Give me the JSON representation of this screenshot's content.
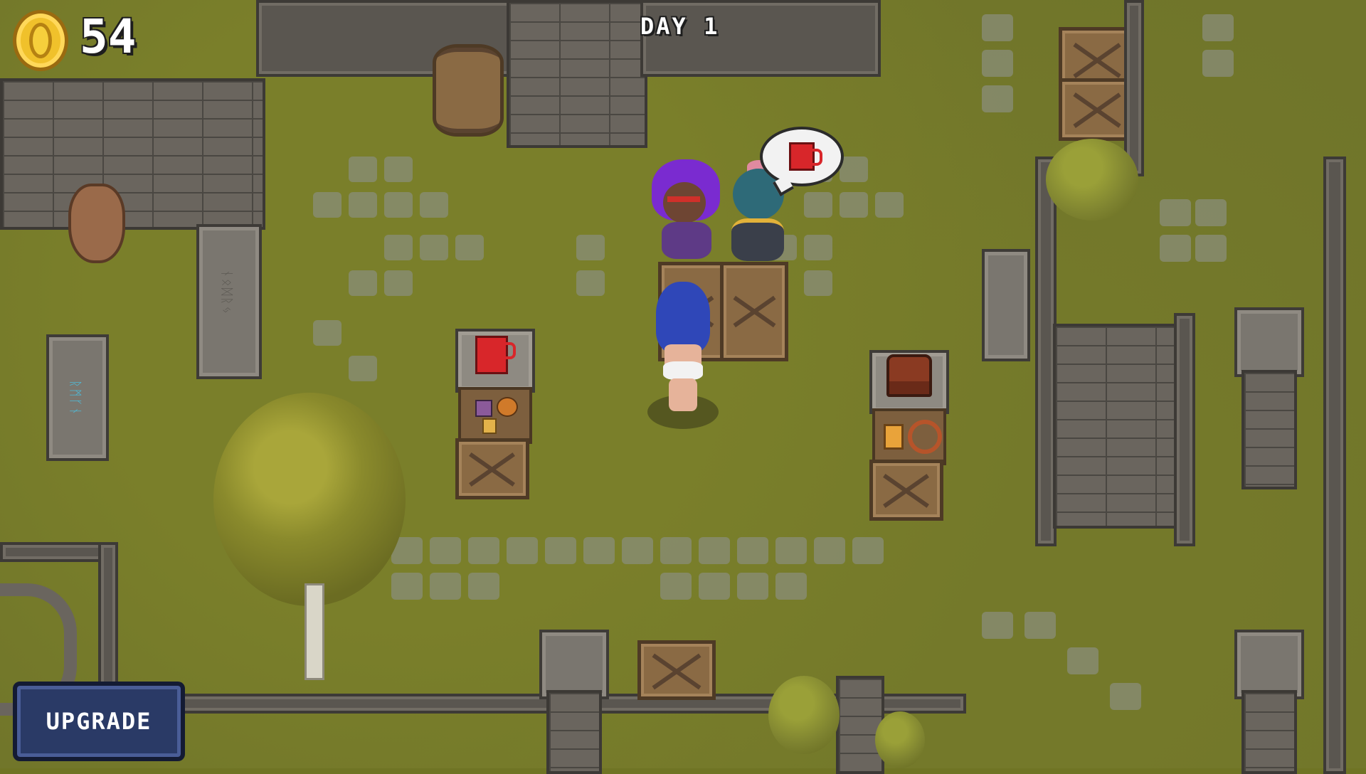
{
  "hud": {
    "coins": "54",
    "day": "DAY 1",
    "coin_color": "#f0c12b"
  },
  "buttons": {
    "upgrade": "UPGRADE",
    "upgrade_color": "#2a3a66"
  },
  "npc_request": {
    "item_icon": "mug-icon",
    "item_color": "#d8262a"
  },
  "stalls": [
    {
      "display_item_icon": "red-mug-icon"
    },
    {
      "display_item_icon": "chest-icon"
    }
  ],
  "icons": {
    "currency": "coin-icon"
  }
}
